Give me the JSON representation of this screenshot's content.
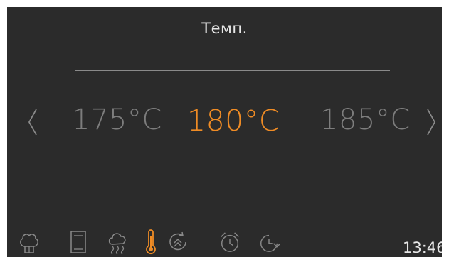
{
  "header": {
    "title": "Темп."
  },
  "temperature": {
    "previous": "175°C",
    "current": "180°C",
    "next": "185°C"
  },
  "navigation": {
    "prev_icon": "chevron-left-icon",
    "next_icon": "chevron-right-icon"
  },
  "toolbar": {
    "items": [
      {
        "icon": "chef-hat-icon"
      },
      {
        "icon": "door-icon"
      },
      {
        "icon": "steam-icon"
      },
      {
        "icon": "thermometer-icon",
        "active": true
      },
      {
        "icon": "fast-heat-icon"
      },
      {
        "icon": "alarm-clock-icon"
      },
      {
        "icon": "delay-timer-icon"
      }
    ]
  },
  "status": {
    "time": "13:46"
  },
  "colors": {
    "background": "#2b2b2b",
    "accent": "#f08c25",
    "text": "#e6e6e6",
    "inactive": "#7d7d7d"
  }
}
